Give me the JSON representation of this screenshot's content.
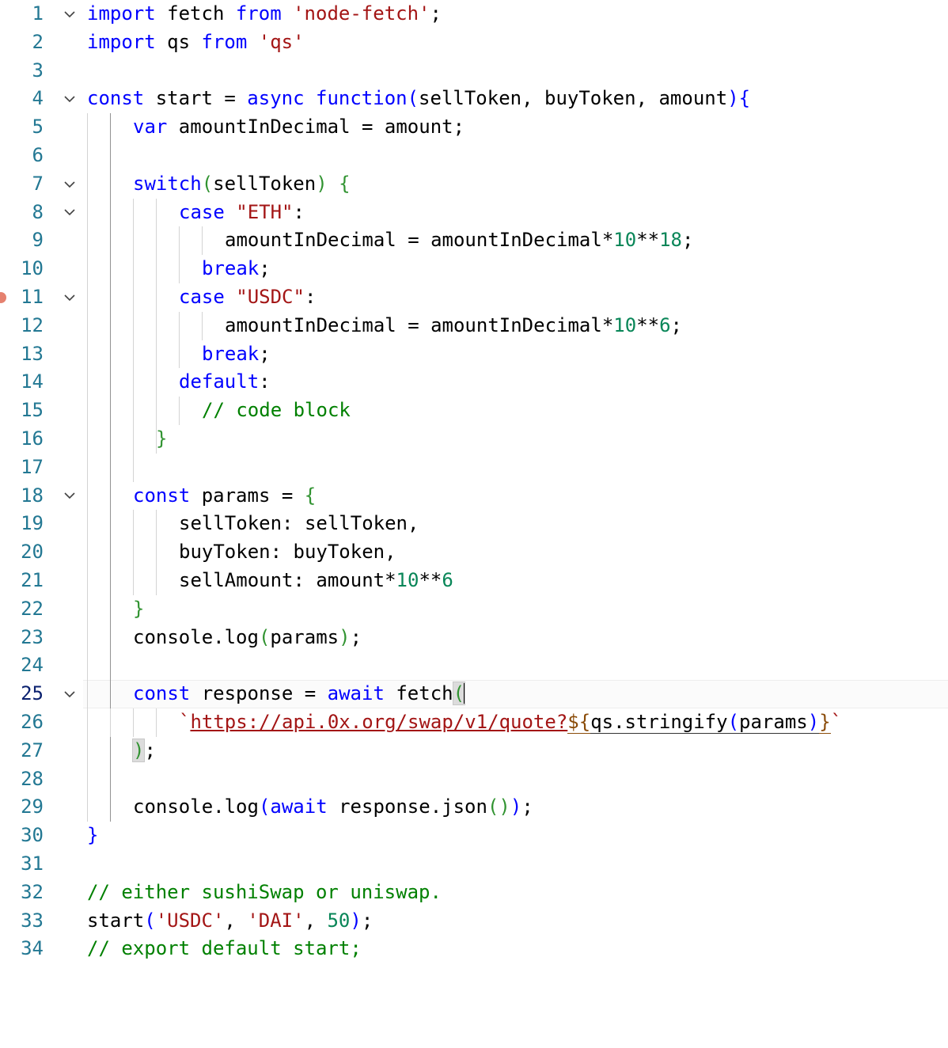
{
  "editor": {
    "name": "code-editor",
    "language": "javascript",
    "theme": "light",
    "font_size_px": 24,
    "line_height_px": 35.8,
    "total_lines": 34,
    "active_line": 25,
    "breakpoint_line": 11,
    "colors": {
      "background": "#ffffff",
      "foreground": "#000000",
      "line_number": "#237893",
      "active_line_number": "#0b216f",
      "keyword": "#0000ff",
      "string": "#a31515",
      "number": "#098658",
      "comment": "#008000",
      "bracket_green": "#319331",
      "template_substitution": "#8a4b08",
      "indent_guide": "#d3d3d3",
      "active_indent_guide": "#939393",
      "breakpoint": "#e5816f",
      "active_line_background": "#fbfbfb",
      "bracket_match_background": "#dcdcdc"
    },
    "folding_lines": [
      1,
      4,
      7,
      8,
      11,
      18,
      25
    ],
    "plain_text": "import fetch from 'node-fetch';\nimport qs from 'qs'\n\nconst start = async function(sellToken, buyToken, amount){\n    var amountInDecimal = amount;\n\n    switch(sellToken) {\n        case \"ETH\":\n            amountInDecimal = amountInDecimal*10**18;\n          break;\n        case \"USDC\":\n            amountInDecimal = amountInDecimal*10**6;\n          break;\n        default:\n          // code block\n      }\n\n    const params = {\n        sellToken: sellToken,\n        buyToken: buyToken,\n        sellAmount: amount*10**6\n    }\n    console.log(params);\n\n    const response = await fetch(\n        `https://api.0x.org/swap/v1/quote?${qs.stringify(params)}`\n    );\n\n    console.log(await response.json());\n}\n\n// either sushiSwap or uniswap.\nstart('USDC', 'DAI', 50);\n// export default start;",
    "lines": [
      {
        "n": "1",
        "fold": true,
        "guides": []
      },
      {
        "n": "2",
        "fold": false,
        "guides": []
      },
      {
        "n": "3",
        "fold": false,
        "guides": []
      },
      {
        "n": "4",
        "fold": true,
        "guides": []
      },
      {
        "n": "5",
        "fold": false,
        "guides": [
          1,
          2
        ]
      },
      {
        "n": "6",
        "fold": false,
        "guides": [
          1,
          2
        ]
      },
      {
        "n": "7",
        "fold": true,
        "guides": [
          1,
          2
        ]
      },
      {
        "n": "8",
        "fold": true,
        "guides": [
          1,
          2,
          3,
          4
        ]
      },
      {
        "n": "9",
        "fold": false,
        "guides": [
          1,
          2,
          3,
          4,
          5,
          6
        ]
      },
      {
        "n": "10",
        "fold": false,
        "guides": [
          1,
          2,
          3,
          4,
          5
        ]
      },
      {
        "n": "11",
        "fold": true,
        "guides": [
          1,
          2,
          3,
          4
        ]
      },
      {
        "n": "12",
        "fold": false,
        "guides": [
          1,
          2,
          3,
          4,
          5,
          6
        ]
      },
      {
        "n": "13",
        "fold": false,
        "guides": [
          1,
          2,
          3,
          4,
          5
        ]
      },
      {
        "n": "14",
        "fold": false,
        "guides": [
          1,
          2,
          3,
          4
        ]
      },
      {
        "n": "15",
        "fold": false,
        "guides": [
          1,
          2,
          3,
          4,
          5
        ]
      },
      {
        "n": "16",
        "fold": false,
        "guides": [
          1,
          2,
          3,
          4
        ]
      },
      {
        "n": "17",
        "fold": false,
        "guides": [
          1,
          2,
          3
        ]
      },
      {
        "n": "18",
        "fold": true,
        "guides": [
          1,
          2
        ]
      },
      {
        "n": "19",
        "fold": false,
        "guides": [
          1,
          2,
          3,
          4
        ]
      },
      {
        "n": "20",
        "fold": false,
        "guides": [
          1,
          2,
          3,
          4
        ]
      },
      {
        "n": "21",
        "fold": false,
        "guides": [
          1,
          2,
          3,
          4
        ]
      },
      {
        "n": "22",
        "fold": false,
        "guides": [
          1,
          2
        ]
      },
      {
        "n": "23",
        "fold": false,
        "guides": [
          1,
          2
        ]
      },
      {
        "n": "24",
        "fold": false,
        "guides": [
          1,
          2
        ]
      },
      {
        "n": "25",
        "fold": true,
        "guides": [
          1,
          2
        ]
      },
      {
        "n": "26",
        "fold": false,
        "guides": [
          1,
          2,
          3,
          4
        ]
      },
      {
        "n": "27",
        "fold": false,
        "guides": [
          1,
          2
        ]
      },
      {
        "n": "28",
        "fold": false,
        "guides": [
          1,
          2
        ]
      },
      {
        "n": "29",
        "fold": false,
        "guides": [
          1,
          2
        ]
      },
      {
        "n": "30",
        "fold": false,
        "guides": []
      },
      {
        "n": "31",
        "fold": false,
        "guides": []
      },
      {
        "n": "32",
        "fold": false,
        "guides": []
      },
      {
        "n": "33",
        "fold": false,
        "guides": []
      },
      {
        "n": "34",
        "fold": false,
        "guides": []
      }
    ],
    "code_text": {
      "l1": {
        "t1": "import",
        "t2": " fetch ",
        "t3": "from",
        "t4": " ",
        "t5": "'node-fetch'",
        "t6": ";"
      },
      "l2": {
        "t1": "import",
        "t2": " qs ",
        "t3": "from",
        "t4": " ",
        "t5": "'qs'"
      },
      "l4": {
        "t1": "const",
        "t2": " start = ",
        "t3": "async",
        "t4": " ",
        "t5": "function",
        "t6": "(",
        "t7": "sellToken, buyToken, amount",
        "t8": ")",
        "t9": "{"
      },
      "l5": {
        "t1": "var",
        "t2": " amountInDecimal = amount;"
      },
      "l7": {
        "t1": "switch",
        "t2": "(",
        "t3": "sellToken",
        "t4": ")",
        "t5": " ",
        "t6": "{"
      },
      "l8": {
        "t1": "case",
        "t2": " ",
        "t3": "\"ETH\"",
        "t4": ":"
      },
      "l9": {
        "t1": "amountInDecimal = amountInDecimal*",
        "t2": "10",
        "t3": "**",
        "t4": "18",
        "t5": ";"
      },
      "l10": {
        "t1": "break",
        "t2": ";"
      },
      "l11": {
        "t1": "case",
        "t2": " ",
        "t3": "\"USDC\"",
        "t4": ":"
      },
      "l12": {
        "t1": "amountInDecimal = amountInDecimal*",
        "t2": "10",
        "t3": "**",
        "t4": "6",
        "t5": ";"
      },
      "l13": {
        "t1": "break",
        "t2": ";"
      },
      "l14": {
        "t1": "default",
        "t2": ":"
      },
      "l15": {
        "t1": "// code block"
      },
      "l16": {
        "t1": "}"
      },
      "l18": {
        "t1": "const",
        "t2": " params = ",
        "t3": "{"
      },
      "l19": {
        "t1": "sellToken: sellToken,"
      },
      "l20": {
        "t1": "buyToken: buyToken,"
      },
      "l21": {
        "t1": "sellAmount: amount*",
        "t2": "10",
        "t3": "**",
        "t4": "6"
      },
      "l22": {
        "t1": "}"
      },
      "l23": {
        "t1": "console.log",
        "t2": "(",
        "t3": "params",
        "t4": ")",
        "t5": ";"
      },
      "l25": {
        "t1": "const",
        "t2": " response = ",
        "t3": "await",
        "t4": " fetch",
        "t5": "("
      },
      "l26": {
        "t1": "`",
        "t2": "https://api.0x.org/swap/v1/quote?",
        "t3": "${",
        "t4": "qs.stringify",
        "t5": "(",
        "t6": "params",
        "t7": ")",
        "t8": "}",
        "t9": "`"
      },
      "l27": {
        "t1": ")",
        "t2": ";"
      },
      "l29": {
        "t1": "console.log",
        "t2": "(",
        "t3": "await",
        "t4": " response.json",
        "t5": "()",
        "t6": ")",
        "t7": ";"
      },
      "l30": {
        "t1": "}"
      },
      "l32": {
        "t1": "// either sushiSwap or uniswap."
      },
      "l33": {
        "t1": "start",
        "t2": "(",
        "t3": "'USDC'",
        "t4": ", ",
        "t5": "'DAI'",
        "t6": ", ",
        "t7": "50",
        "t8": ")",
        "t9": ";"
      },
      "l34": {
        "t1": "// export default start;"
      }
    }
  }
}
